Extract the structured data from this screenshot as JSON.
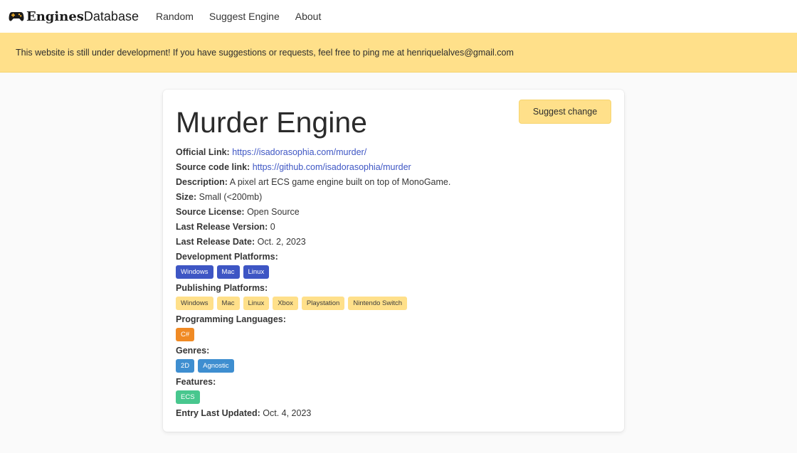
{
  "nav": {
    "brand_bold": "Engines",
    "brand_light": "Database",
    "links": [
      "Random",
      "Suggest Engine",
      "About"
    ]
  },
  "notice": "This website is still under development! If you have suggestions or requests, feel free to ping me at henriquelalves@gmail.com",
  "engine": {
    "title": "Murder Engine",
    "suggest_label": "Suggest change",
    "official_link_label": "Official Link:",
    "official_link": "https://isadorasophia.com/murder/",
    "source_link_label": "Source code link:",
    "source_link": "https://github.com/isadorasophia/murder",
    "description_label": "Description:",
    "description": "A pixel art ECS game engine built on top of MonoGame.",
    "size_label": "Size:",
    "size": "Small (<200mb)",
    "license_label": "Source License:",
    "license": "Open Source",
    "release_version_label": "Last Release Version:",
    "release_version": "0",
    "release_date_label": "Last Release Date:",
    "release_date": "Oct. 2, 2023",
    "dev_platforms_label": "Development Platforms:",
    "dev_platforms": [
      "Windows",
      "Mac",
      "Linux"
    ],
    "pub_platforms_label": "Publishing Platforms:",
    "pub_platforms": [
      "Windows",
      "Mac",
      "Linux",
      "Xbox",
      "Playstation",
      "Nintendo Switch"
    ],
    "languages_label": "Programming Languages:",
    "languages": [
      "C#"
    ],
    "genres_label": "Genres:",
    "genres": [
      "2D",
      "Agnostic"
    ],
    "features_label": "Features:",
    "features": [
      "ECS"
    ],
    "updated_label": "Entry Last Updated:",
    "updated": "Oct. 4, 2023"
  },
  "colors": {
    "warning": "#ffe08a",
    "link": "#3e56c4",
    "orange": "#f08a24",
    "info": "#3e8ed0",
    "success": "#48c78e"
  },
  "icons": {
    "brand": "gamepad-icon"
  }
}
